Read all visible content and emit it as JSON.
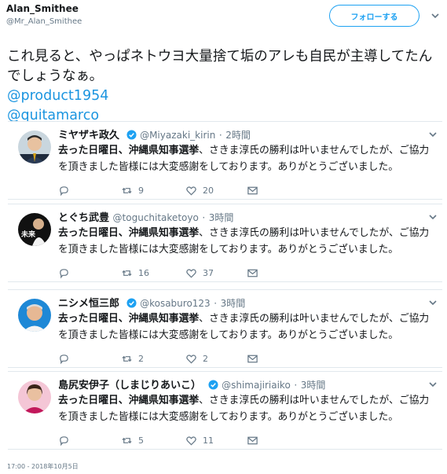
{
  "author": {
    "name": "Alan_Smithee",
    "handle": "@Mr_Alan_Smithee",
    "follow_label": "フォローする"
  },
  "tweet_text": "これ見ると、やっぱネトウヨ大量捨て垢のアレも自民が主導してたんでしょうなぁ。",
  "mentions": [
    "@product1954",
    "@quitamarco"
  ],
  "quoted": [
    {
      "name": "ミヤザキ政久",
      "handle": "@Miyazaki_kirin",
      "sep": "·",
      "time": "2時間",
      "verified": true,
      "body_bold": "去った日曜日、沖縄県知事選挙",
      "body_rest": "、さきま淳氏の勝利は叶いませんでしたが、ご協力を頂きました皆様には大変感謝をしております。ありがとうございました。",
      "retweets": "9",
      "likes": "20"
    },
    {
      "name": "とぐち武豊",
      "handle": "@toguchitaketoyo",
      "sep": "·",
      "time": "3時間",
      "verified": false,
      "body_bold": "去った日曜日、沖縄県知事選挙",
      "body_rest": "、さきま淳氏の勝利は叶いませんでしたが、ご協力を頂きました皆様には大変感謝をしております。ありがとうございました。",
      "retweets": "16",
      "likes": "37"
    },
    {
      "name": "ニシメ恒三郎",
      "handle": "@kosaburo123",
      "sep": "·",
      "time": "3時間",
      "verified": true,
      "body_bold": "去った日曜日、沖縄県知事選挙",
      "body_rest": "、さきま淳氏の勝利は叶いませんでしたが、ご協力を頂きました皆様には大変感謝をしております。ありがとうございました。",
      "retweets": "2",
      "likes": "2"
    },
    {
      "name": "島尻安伊子（しまじりあいこ）",
      "handle": "@shimajiriaiko",
      "sep": "·",
      "time": "3時間",
      "verified": true,
      "body_bold": "去った日曜日、沖縄県知事選挙",
      "body_rest": "、さきま淳氏の勝利は叶いませんでしたが、ご協力を頂きました皆様には大変感謝をしております。ありがとうございました。",
      "retweets": "5",
      "likes": "11"
    }
  ],
  "avatar_badge": "未来",
  "timestamp": "17:00 - 2018年10月5日",
  "colors": {
    "accent": "#1da1f2",
    "link": "#1b95e0",
    "muted": "#657786",
    "border": "#e1e8ed",
    "text": "#14171a"
  },
  "icons": [
    "chevron-down-icon",
    "verified-badge-icon",
    "reply-icon",
    "retweet-icon",
    "like-icon",
    "direct-message-icon"
  ]
}
